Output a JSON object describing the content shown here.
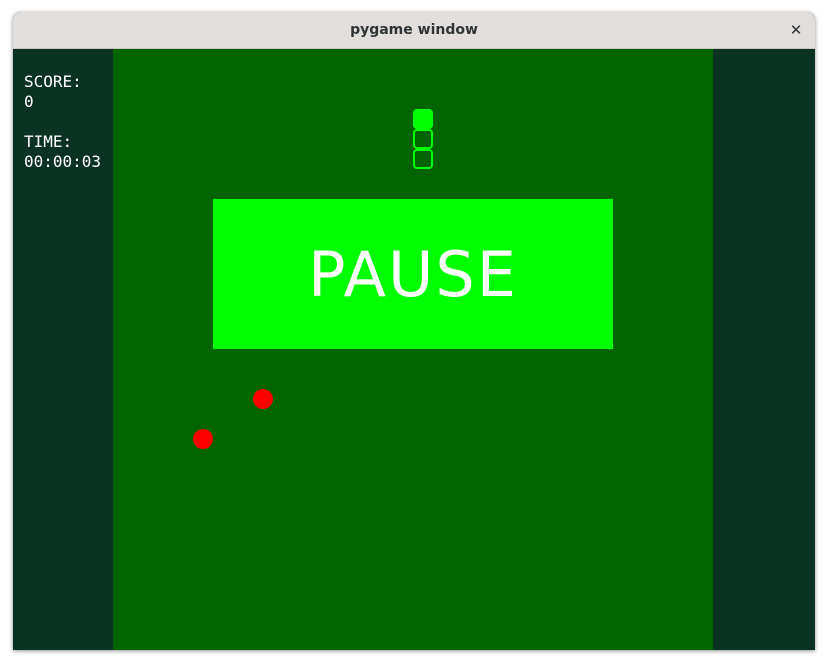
{
  "window": {
    "title": "pygame window",
    "close_glyph": "✕"
  },
  "hud": {
    "score_label": "SCORE:",
    "score_value": "0",
    "time_label": "TIME:",
    "time_value": "00:00:03"
  },
  "overlay": {
    "pause_text": "PAUSE"
  },
  "colors": {
    "sidebar_bg": "#0a3323",
    "playfield_bg": "#006400",
    "snake": "#00ff00",
    "pause_panel": "#00ff00",
    "food": "#ff0000",
    "hud_text": "#ffffff"
  },
  "icons": {
    "close": "close-icon"
  }
}
